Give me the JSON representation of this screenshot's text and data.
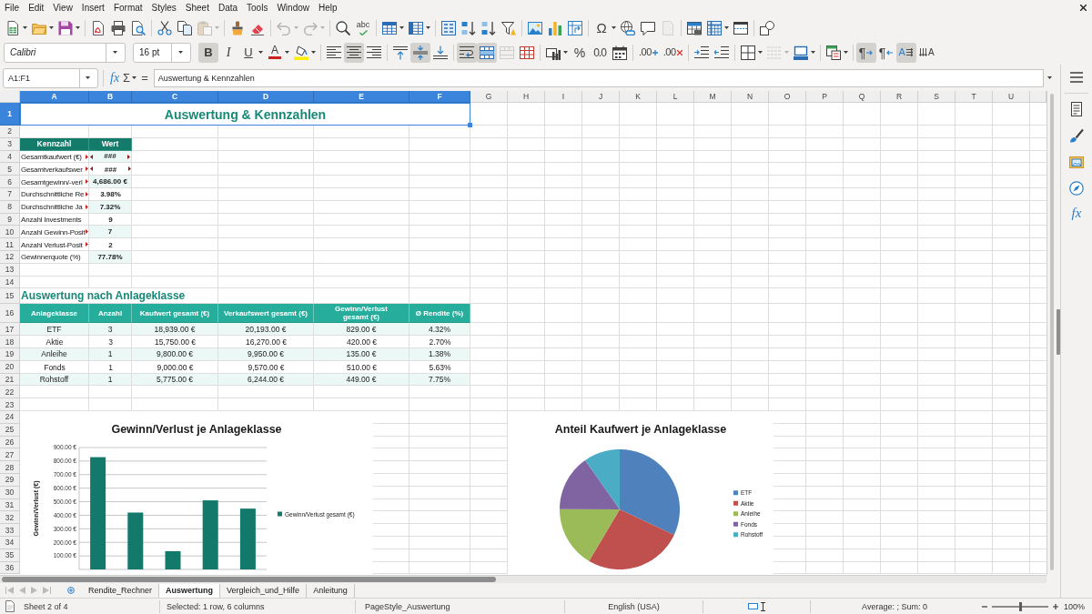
{
  "menu_bar": {
    "items": [
      "File",
      "Edit",
      "View",
      "Insert",
      "Format",
      "Styles",
      "Sheet",
      "Data",
      "Tools",
      "Window",
      "Help"
    ]
  },
  "standard_toolbar": {
    "groups": [
      [
        {
          "kind": "newsheet",
          "dropdown": true,
          "disabled": false
        },
        {
          "kind": "open",
          "dropdown": true,
          "disabled": false
        },
        {
          "kind": "save",
          "dropdown": true,
          "disabled": false
        }
      ],
      [
        {
          "kind": "pdf",
          "dropdown": false,
          "disabled": false
        },
        {
          "kind": "print",
          "dropdown": false,
          "disabled": false
        },
        {
          "kind": "preview",
          "dropdown": false,
          "disabled": false
        }
      ],
      [
        {
          "kind": "cut",
          "dropdown": false,
          "disabled": false
        },
        {
          "kind": "copy",
          "dropdown": false,
          "disabled": false
        },
        {
          "kind": "paste",
          "dropdown": true,
          "disabled": true
        }
      ],
      [
        {
          "kind": "clone",
          "dropdown": false,
          "disabled": false
        },
        {
          "kind": "clear",
          "dropdown": false,
          "disabled": false
        }
      ],
      [
        {
          "kind": "undo",
          "dropdown": true,
          "disabled": true
        },
        {
          "kind": "redo",
          "dropdown": true,
          "disabled": true
        }
      ],
      [
        {
          "kind": "find",
          "dropdown": false,
          "disabled": false
        },
        {
          "kind": "spelling",
          "glyph": "abc",
          "dropdown": false,
          "disabled": false
        }
      ],
      [
        {
          "kind": "rows",
          "dropdown": true,
          "disabled": false
        },
        {
          "kind": "columns",
          "dropdown": true,
          "disabled": false
        }
      ],
      [
        {
          "kind": "sort",
          "dropdown": false,
          "disabled": false
        },
        {
          "kind": "sortasc",
          "dropdown": false,
          "disabled": false
        },
        {
          "kind": "sortdesc",
          "dropdown": false,
          "disabled": false
        },
        {
          "kind": "filter",
          "dropdown": false,
          "disabled": false
        }
      ],
      [
        {
          "kind": "image",
          "dropdown": false,
          "disabled": false
        },
        {
          "kind": "chart",
          "dropdown": false,
          "disabled": false
        },
        {
          "kind": "pivot",
          "dropdown": false,
          "disabled": false
        }
      ],
      [
        {
          "kind": "special",
          "glyph": "Ω",
          "dropdown": true,
          "disabled": false
        },
        {
          "kind": "hyperlink",
          "dropdown": false,
          "disabled": false
        },
        {
          "kind": "comment",
          "dropdown": false,
          "disabled": false
        },
        {
          "kind": "headerfooter",
          "dropdown": false,
          "disabled": true
        }
      ],
      [
        {
          "kind": "printarea",
          "dropdown": false,
          "disabled": false
        },
        {
          "kind": "freeze",
          "dropdown": true,
          "disabled": false
        },
        {
          "kind": "split",
          "dropdown": false,
          "disabled": false
        }
      ],
      [
        {
          "kind": "draw",
          "dropdown": false,
          "disabled": false
        }
      ]
    ]
  },
  "formatting_toolbar": {
    "font_name": "Calibri",
    "font_size": "16 pt",
    "groups": [
      [
        {
          "kind": "bold",
          "glyph": "B",
          "active": true,
          "disabled": false,
          "dropdown": false
        },
        {
          "kind": "italic",
          "glyph": "I",
          "active": false,
          "disabled": false,
          "dropdown": false
        },
        {
          "kind": "underline",
          "glyph": "U",
          "active": false,
          "disabled": false,
          "dropdown": true
        },
        {
          "kind": "fontcolor",
          "glyph": "A",
          "active": false,
          "disabled": false,
          "dropdown": true
        },
        {
          "kind": "highlight",
          "active": false,
          "disabled": false,
          "dropdown": true
        }
      ],
      [
        {
          "kind": "alignleft",
          "active": false,
          "disabled": false,
          "dropdown": false
        },
        {
          "kind": "aligncenter",
          "active": true,
          "disabled": false,
          "dropdown": false
        },
        {
          "kind": "alignright",
          "active": false,
          "disabled": false,
          "dropdown": false
        }
      ],
      [
        {
          "kind": "aligntop",
          "active": false,
          "disabled": false,
          "dropdown": false
        },
        {
          "kind": "alignmiddle",
          "active": true,
          "disabled": false,
          "dropdown": false
        },
        {
          "kind": "alignbottom",
          "active": false,
          "disabled": false,
          "dropdown": false
        }
      ],
      [
        {
          "kind": "wrap",
          "active": true,
          "disabled": false,
          "dropdown": false
        },
        {
          "kind": "mergecenter",
          "active": true,
          "disabled": false,
          "dropdown": false
        },
        {
          "kind": "merge",
          "active": false,
          "disabled": true,
          "dropdown": false
        },
        {
          "kind": "unmerge",
          "active": false,
          "disabled": false,
          "dropdown": false
        }
      ],
      [
        {
          "kind": "currency",
          "active": false,
          "disabled": false,
          "dropdown": true
        },
        {
          "kind": "percent",
          "glyph": "%",
          "active": false,
          "disabled": false,
          "dropdown": false
        },
        {
          "kind": "number",
          "glyph": "0.0",
          "active": false,
          "disabled": false,
          "dropdown": false
        },
        {
          "kind": "date",
          "active": false,
          "disabled": false,
          "dropdown": false
        }
      ],
      [
        {
          "kind": "adddecimal",
          "glyph": ".00",
          "active": false,
          "disabled": false,
          "dropdown": false
        },
        {
          "kind": "deldecimal",
          "glyph": ".00",
          "active": false,
          "disabled": false,
          "dropdown": false
        }
      ],
      [
        {
          "kind": "indent",
          "active": false,
          "disabled": false,
          "dropdown": false
        },
        {
          "kind": "outdent",
          "active": false,
          "disabled": false,
          "dropdown": false
        }
      ],
      [
        {
          "kind": "borders",
          "active": false,
          "disabled": false,
          "dropdown": true
        },
        {
          "kind": "borderstyle",
          "active": false,
          "disabled": true,
          "dropdown": true
        },
        {
          "kind": "bordercolor",
          "active": false,
          "disabled": false,
          "dropdown": true
        }
      ],
      [
        {
          "kind": "conditional",
          "active": false,
          "disabled": false,
          "dropdown": true
        }
      ],
      [
        {
          "kind": "ltr",
          "glyph": "¶",
          "active": true,
          "disabled": false,
          "dropdown": false
        },
        {
          "kind": "rtl",
          "glyph": "¶",
          "active": false,
          "disabled": false,
          "dropdown": false
        },
        {
          "kind": "textdir",
          "glyph": "A",
          "active": true,
          "disabled": false,
          "dropdown": false
        },
        {
          "kind": "textvertical",
          "glyph": "A",
          "active": false,
          "disabled": false,
          "dropdown": false
        }
      ]
    ]
  },
  "formula_bar": {
    "name_box": "A1:F1",
    "function_wizard": "fx",
    "sum": "Σ",
    "equals": "=",
    "content": "Auswertung & Kennzahlen"
  },
  "sheet": {
    "columns": [
      {
        "label": "A",
        "selected": true
      },
      {
        "label": "B",
        "selected": true
      },
      {
        "label": "C",
        "selected": true
      },
      {
        "label": "D",
        "selected": true
      },
      {
        "label": "E",
        "selected": true
      },
      {
        "label": "F",
        "selected": true
      },
      {
        "label": "G",
        "selected": false
      },
      {
        "label": "H",
        "selected": false
      },
      {
        "label": "I",
        "selected": false
      },
      {
        "label": "J",
        "selected": false
      },
      {
        "label": "K",
        "selected": false
      },
      {
        "label": "L",
        "selected": false
      },
      {
        "label": "M",
        "selected": false
      },
      {
        "label": "N",
        "selected": false
      },
      {
        "label": "O",
        "selected": false
      },
      {
        "label": "P",
        "selected": false
      },
      {
        "label": "Q",
        "selected": false
      },
      {
        "label": "R",
        "selected": false
      },
      {
        "label": "S",
        "selected": false
      },
      {
        "label": "T",
        "selected": false
      },
      {
        "label": "U",
        "selected": false
      }
    ],
    "rows": [
      {
        "label": "1",
        "selected": true
      },
      {
        "label": "2",
        "selected": false
      },
      {
        "label": "3",
        "selected": false
      },
      {
        "label": "4",
        "selected": false
      },
      {
        "label": "5",
        "selected": false
      },
      {
        "label": "6",
        "selected": false
      },
      {
        "label": "7",
        "selected": false
      },
      {
        "label": "8",
        "selected": false
      },
      {
        "label": "9",
        "selected": false
      },
      {
        "label": "10",
        "selected": false
      },
      {
        "label": "11",
        "selected": false
      },
      {
        "label": "12",
        "selected": false
      },
      {
        "label": "13",
        "selected": false
      },
      {
        "label": "14",
        "selected": false
      },
      {
        "label": "15",
        "selected": false
      },
      {
        "label": "16",
        "selected": false
      },
      {
        "label": "17",
        "selected": false
      },
      {
        "label": "18",
        "selected": false
      },
      {
        "label": "19",
        "selected": false
      },
      {
        "label": "20",
        "selected": false
      },
      {
        "label": "21",
        "selected": false
      },
      {
        "label": "22",
        "selected": false
      },
      {
        "label": "23",
        "selected": false
      },
      {
        "label": "24",
        "selected": false
      },
      {
        "label": "25",
        "selected": false
      },
      {
        "label": "26",
        "selected": false
      },
      {
        "label": "27",
        "selected": false
      },
      {
        "label": "28",
        "selected": false
      },
      {
        "label": "29",
        "selected": false
      },
      {
        "label": "30",
        "selected": false
      },
      {
        "label": "31",
        "selected": false
      },
      {
        "label": "32",
        "selected": false
      },
      {
        "label": "33",
        "selected": false
      },
      {
        "label": "34",
        "selected": false
      },
      {
        "label": "35",
        "selected": false
      },
      {
        "label": "36",
        "selected": false
      }
    ],
    "title": {
      "text": "Auswertung & Kennzahlen",
      "selected": true
    },
    "kpi_table": {
      "columns": [
        "Kennzahl",
        "Wert"
      ],
      "rows": [
        {
          "label": "Gesamtkaufwert (€)",
          "label_clipped": true,
          "value": "###",
          "value_clipped": true
        },
        {
          "label": "Gesamtverkaufswer",
          "label_clipped": true,
          "value": "###",
          "value_clipped": true
        },
        {
          "label": "Gesamtgewinn/-verl",
          "label_clipped": true,
          "value": "4,686.00 €",
          "value_clipped": false
        },
        {
          "label": "Durchschnittliche Re",
          "label_clipped": true,
          "value": "3.98%",
          "value_clipped": false
        },
        {
          "label": "Durchschnittliche Ja",
          "label_clipped": true,
          "value": "7.32%",
          "value_clipped": false
        },
        {
          "label": "Anzahl Investments",
          "label_clipped": false,
          "value": "9",
          "value_clipped": false
        },
        {
          "label": "Anzahl Gewinn-Posit",
          "label_clipped": true,
          "value": "7",
          "value_clipped": false
        },
        {
          "label": "Anzahl Verlust-Posit",
          "label_clipped": true,
          "value": "2",
          "value_clipped": false
        },
        {
          "label": "Gewinnerquote (%)",
          "label_clipped": false,
          "value": "77.78%",
          "value_clipped": false
        }
      ]
    },
    "section_heading": "Auswertung nach Anlageklasse",
    "class_table": {
      "columns": [
        "Anlageklasse",
        "Anzahl",
        "Kaufwert gesamt (€)",
        "Verkaufswert gesamt (€)",
        "Gewinn/Verlust gesamt (€)",
        "Ø Rendite (%)"
      ],
      "rows": [
        [
          "ETF",
          "3",
          "18,939.00 €",
          "20,193.00 €",
          "829.00 €",
          "4.32%"
        ],
        [
          "Aktie",
          "3",
          "15,750.00 €",
          "16,270.00 €",
          "420.00 €",
          "2.70%"
        ],
        [
          "Anleihe",
          "1",
          "9,800.00 €",
          "9,950.00 €",
          "135.00 €",
          "1.38%"
        ],
        [
          "Fonds",
          "1",
          "9,000.00 €",
          "9,570.00 €",
          "510.00 €",
          "5.63%"
        ],
        [
          "Rohstoff",
          "1",
          "5,775.00 €",
          "6,244.00 €",
          "449.00 €",
          "7.75%"
        ]
      ]
    },
    "charts": [
      {
        "chart_data": {
          "type": "bar",
          "title": "Gewinn/Verlust je Anlageklasse",
          "ylabel": "Gewinn/Verlust (€)",
          "series": [
            {
              "name": "Gewinn/Verlust gesamt (€)",
              "color": "#13796b",
              "values": [
                829,
                420,
                135,
                510,
                449
              ]
            }
          ],
          "ylim": [
            0,
            900
          ],
          "yticks": [
            {
              "value": 100,
              "label": "100.00 €"
            },
            {
              "value": 200,
              "label": "200.00 €"
            },
            {
              "value": 300,
              "label": "300.00 €"
            },
            {
              "value": 400,
              "label": "400.00 €"
            },
            {
              "value": 500,
              "label": "500.00 €"
            },
            {
              "value": 600,
              "label": "600.00 €"
            },
            {
              "value": 700,
              "label": "700.00 €"
            },
            {
              "value": 800,
              "label": "800.00 €"
            },
            {
              "value": 900,
              "label": "900.00 €"
            }
          ],
          "grid": true,
          "legend": "right"
        }
      },
      {
        "chart_data": {
          "type": "pie",
          "title": "Anteil Kaufwert je Anlageklasse",
          "categories": [
            "ETF",
            "Aktie",
            "Anleihe",
            "Fonds",
            "Rohstoff"
          ],
          "values": [
            31.96,
            26.58,
            16.53,
            15.19,
            9.74
          ],
          "colors": [
            "#4f81bd",
            "#c0504d",
            "#9bbb59",
            "#8064a2",
            "#4bacc6"
          ],
          "legend": "right"
        }
      }
    ]
  },
  "sheet_tabs": {
    "navigation": [
      {
        "kind": "first",
        "disabled": true
      },
      {
        "kind": "previous",
        "disabled": true
      },
      {
        "kind": "next",
        "disabled": true
      },
      {
        "kind": "last",
        "disabled": true
      }
    ],
    "tabs": [
      {
        "label": "Rendite_Rechner",
        "selected": false
      },
      {
        "label": "Auswertung",
        "selected": true
      },
      {
        "label": "Vergleich_und_Hilfe",
        "selected": false
      },
      {
        "label": "Anleitung",
        "selected": false
      }
    ]
  },
  "sidebar": {
    "items": [
      {
        "kind": "menu"
      },
      {
        "kind": "properties"
      },
      {
        "kind": "styles"
      },
      {
        "kind": "gallery"
      },
      {
        "kind": "navigator"
      },
      {
        "kind": "functions",
        "glyph": "fx"
      }
    ]
  },
  "status_bar": {
    "sheet": "Sheet 2 of 4",
    "selection": "Selected: 1 row, 6 columns",
    "page_style": "PageStyle_Auswertung",
    "language": "English (USA)",
    "summary": "Average: ; Sum: 0",
    "zoom": {
      "level": 0.5,
      "reading": "100%"
    }
  }
}
